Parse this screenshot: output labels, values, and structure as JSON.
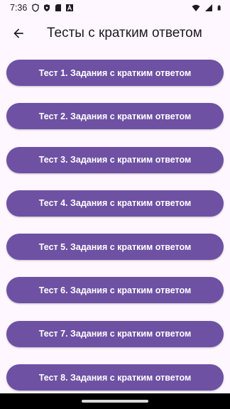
{
  "status_bar": {
    "time": "7:36",
    "left_icons": [
      "shield-icon",
      "vpn-icon",
      "sd-card-icon",
      "font-icon"
    ],
    "right_icons": [
      "wifi-icon",
      "signal-icon",
      "battery-icon"
    ]
  },
  "app_bar": {
    "back_icon": "arrow-back-icon",
    "title": "Тесты с кратким ответом"
  },
  "tests": [
    {
      "label": "Тест 1. Задания с кратким ответом"
    },
    {
      "label": "Тест 2. Задания с кратким ответом"
    },
    {
      "label": "Тест 3. Задания с кратким ответом"
    },
    {
      "label": "Тест 4. Задания с кратким ответом"
    },
    {
      "label": "Тест 5. Задания с кратким ответом"
    },
    {
      "label": "Тест 6. Задания с кратким ответом"
    },
    {
      "label": "Тест 7. Задания с кратким ответом"
    },
    {
      "label": "Тест 8. Задания с кратким ответом"
    }
  ],
  "colors": {
    "background": "#FEF7FF",
    "button": "#6E51A3",
    "button_text": "#FFFFFF"
  }
}
